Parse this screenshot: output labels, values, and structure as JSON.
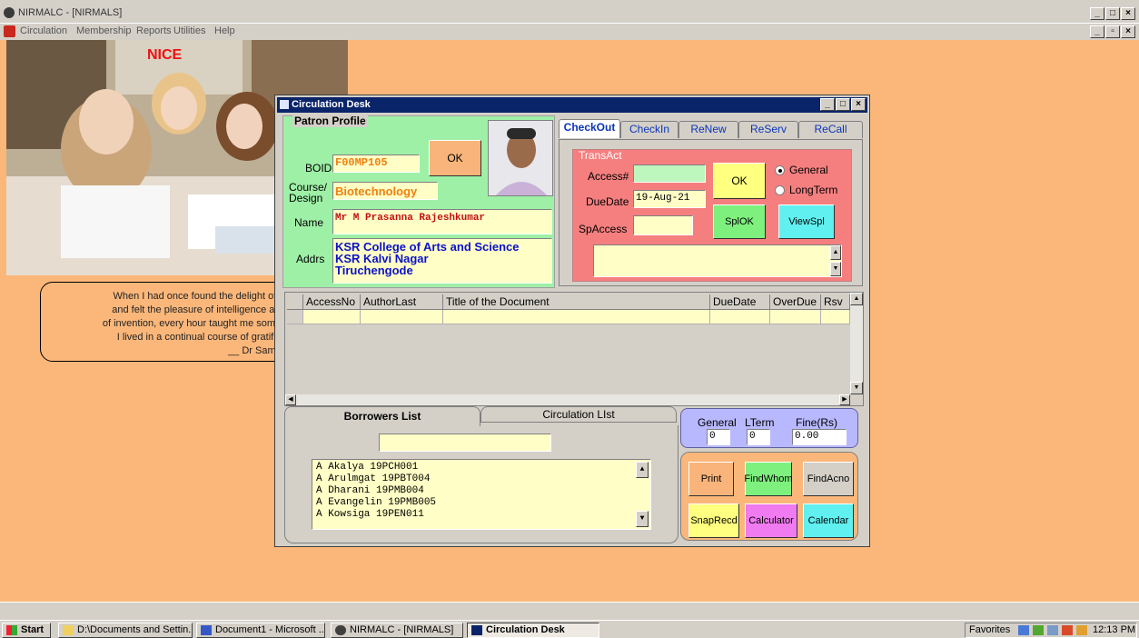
{
  "app": {
    "title": "NIRMALC - [NIRMALS]",
    "menu": [
      "Circulation",
      "Membership",
      "Reports",
      "Utilities",
      "Help"
    ]
  },
  "banner": {
    "text": "NICE"
  },
  "quote": {
    "lines": [
      "When I had once found the delight of know",
      "and felt the pleasure of intelligence and the",
      "of invention, every hour taught me something",
      "I lived in a continual course of gratification",
      "__ Dr Samuel Jo"
    ]
  },
  "desk": {
    "title": "Circulation Desk",
    "patron": {
      "legend": "Patron Profile",
      "boid_label": "BOID",
      "boid_value": "F00MP105",
      "ok_label": "OK",
      "course_label_1": "Course/",
      "course_label_2": "Design",
      "course_value": "Biotechnology",
      "name_label": "Name",
      "name_value": "Mr M Prasanna Rajeshkumar",
      "addr_label": "Addrs",
      "addr_lines": [
        "KSR College of Arts and Science",
        "KSR Kalvi Nagar",
        "Tiruchengode"
      ]
    },
    "tabs": [
      "CheckOut",
      "CheckIn",
      "ReNew",
      "ReServ",
      "ReCall"
    ],
    "trans": {
      "legend": "TransAct",
      "access_label": "Access#",
      "duedate_label": "DueDate",
      "duedate_value": "19-Aug-21",
      "spaccess_label": "SpAccess",
      "ok_label": "OK",
      "general_label": "General",
      "longterm_label": "LongTerm",
      "splok_label": "SplOK",
      "viewspl_label": "ViewSpl"
    },
    "grid_headers": [
      "AccessNo",
      "AuthorLast",
      "Title of the Document",
      "DueDate",
      "OverDue",
      "Rsv"
    ],
    "lower_tabs": [
      "Borrowers List",
      "Circulation LIst"
    ],
    "borrowers": [
      "A Akalya  19PCH001",
      "A Arulmgat  19PBT004",
      "A Dharani  19PMB004",
      "A Evangelin  19PMB005",
      "A Kowsiga  19PEN011"
    ],
    "counts": {
      "general_label": "General",
      "lterm_label": "LTerm",
      "fine_label": "Fine(Rs)",
      "general_value": "0",
      "lterm_value": "0",
      "fine_value": "0.00"
    },
    "actions": [
      "Print",
      "FindWhom",
      "FindAcno",
      "SnapRecd",
      "Calculator",
      "Calendar"
    ]
  },
  "taskbar": {
    "start": "Start",
    "tasks": [
      "D:\\Documents and Settin...",
      "Document1 - Microsoft ...",
      "NIRMALC - [NIRMALS]",
      "Circulation Desk"
    ],
    "favorites": "Favorites",
    "time": "12:13 PM"
  },
  "colors": {
    "desktop": "#fbb77a",
    "patron_bg": "#9ef0a6",
    "transact_bg": "#f57f7f",
    "field_bg": "#fffec6",
    "titlebar": "#0a246a"
  }
}
